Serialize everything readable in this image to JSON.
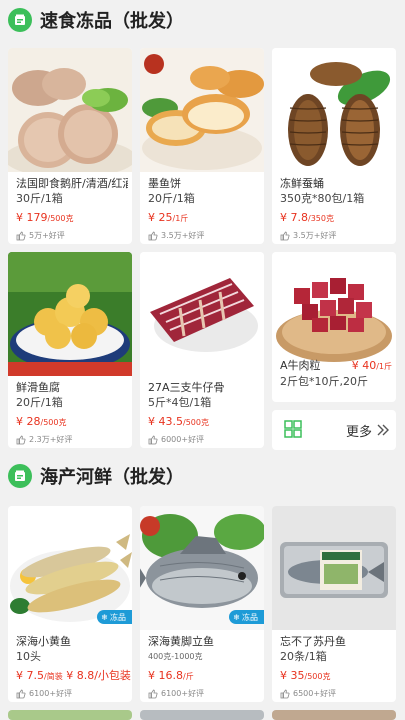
{
  "sections": [
    {
      "title": "速食冻品（批发）",
      "icon": "shop-icon",
      "items": [
        {
          "name": "法国即食鹅肝/清酒/红酒",
          "spec": "30斤/1箱",
          "price": "¥ 179",
          "unit": "/500克",
          "reviews": "5万+好评"
        },
        {
          "name": "墨鱼饼",
          "spec": "20斤/1箱",
          "price": "¥ 25",
          "unit": "/1斤",
          "reviews": "3.5万+好评"
        },
        {
          "name": "冻鲜蚕蛹",
          "spec": "350克*80包/1箱",
          "price": "¥ 7.8",
          "unit": "/350克",
          "reviews": "3.5万+好评"
        },
        {
          "name": "鲜滑鱼腐",
          "spec": "20斤/1箱",
          "price": "¥ 28",
          "unit": "/500克",
          "reviews": "2.3万+好评"
        },
        {
          "name": "27A三支牛仔骨",
          "spec": "5斤*4包/1箱",
          "price": "¥ 43.5",
          "unit": "/500克",
          "reviews": "6000+好评"
        },
        {
          "name": "A牛肉粒",
          "spec": "2斤包*10斤,20斤",
          "price": "¥ 40",
          "unit": "/1斤",
          "reviews": ""
        }
      ],
      "more_label": "更多"
    },
    {
      "title": "海产河鲜（批发）",
      "icon": "shop-icon",
      "items": [
        {
          "name": "深海小黄鱼",
          "spec": "10头",
          "price": "¥ 7.5",
          "unit": "/简装",
          "price2": "¥ 8.8",
          "unit2": "/小包装",
          "reviews": "6100+好评",
          "tag": "冻品"
        },
        {
          "name": "深海黄脚立鱼",
          "spec": "400克-1000克",
          "price": "¥ 16.8",
          "unit": "/斤",
          "reviews": "6100+好评",
          "tag": "冻品"
        },
        {
          "name": "忘不了苏丹鱼",
          "spec": "20条/1箱",
          "price": "¥ 35",
          "unit": "/500克",
          "reviews": "6500+好评"
        }
      ]
    }
  ],
  "colors": {
    "accent": "#3cbf5a",
    "price": "#e8331f",
    "tag": "#1e9bd7"
  }
}
